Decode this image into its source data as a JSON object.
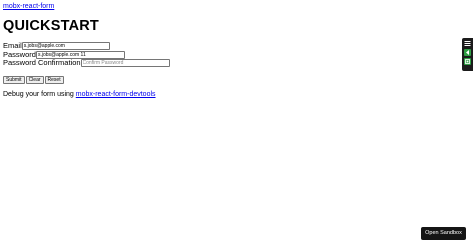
{
  "header": {
    "top_link": "mobx-react-form",
    "title": "QUICKSTART"
  },
  "form": {
    "email": {
      "label": "Email",
      "value": "s.jobs@apple.com",
      "placeholder": ""
    },
    "password": {
      "label": "Password",
      "value": "s.jobs@apple.com 11",
      "placeholder": ""
    },
    "password_confirmation": {
      "label": "Password Confirmation",
      "value": "",
      "placeholder": "Confirm Password"
    },
    "buttons": {
      "submit": "Submit",
      "clear": "Clear",
      "reset": "Reset"
    }
  },
  "debug": {
    "text": "Debug your form using",
    "link": "mobx-react-form-devtools"
  },
  "devtools": {
    "icons": [
      "menu-icon",
      "arrow-left-icon",
      "panel-toggle-icon"
    ],
    "accent": "#2f9e44",
    "background": "#1b1b1b"
  },
  "sandbox": {
    "label": "Open Sandbox"
  }
}
